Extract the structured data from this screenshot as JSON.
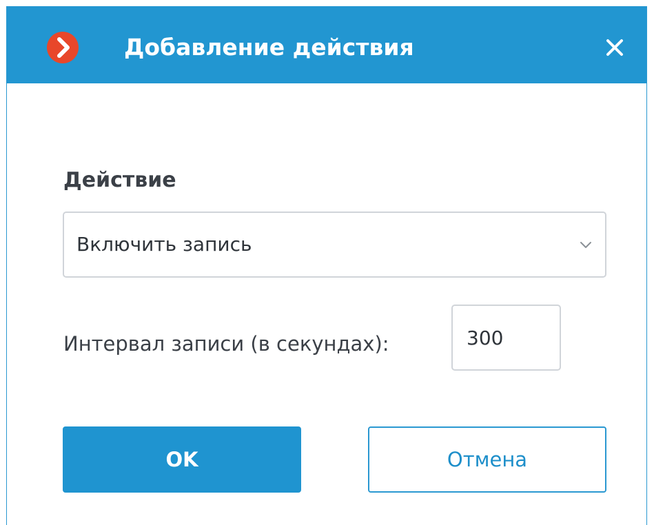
{
  "dialog": {
    "title": "Добавление действия",
    "app_icon": "app-logo-chevron-icon",
    "close_icon": "close-icon"
  },
  "form": {
    "action_label": "Действие",
    "action_select": {
      "value": "Включить запись",
      "icon": "chevron-down-icon"
    },
    "interval_label": "Интервал записи (в секундах):",
    "interval_value": "300"
  },
  "buttons": {
    "ok_label": "OK",
    "cancel_label": "Отмена"
  },
  "colors": {
    "titlebar": "#2296d1",
    "logo": "#e8472a",
    "primary": "#1f94d0",
    "text": "#3b4047"
  }
}
